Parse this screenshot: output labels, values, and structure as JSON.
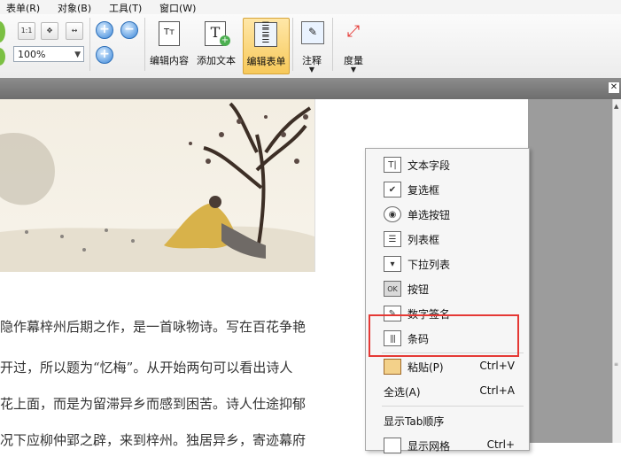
{
  "menubar": {
    "items": [
      "表单(R)",
      "对象(B)",
      "工具(T)",
      "窗口(W)"
    ]
  },
  "toolbar": {
    "zoom_value": "100%",
    "small_left_label": "1:1",
    "edit_content": "编辑内容",
    "add_text": "添加文本",
    "edit_form": "编辑表单",
    "annotate": "注释",
    "measure": "度量"
  },
  "document": {
    "lines": [
      "隐作幕梓州后期之作，是一首咏物诗。写在百花争艳",
      "开过，所以题为“忆梅”。从开始两句可以看出诗人",
      "花上面，而是为留滞异乡而感到困苦。诗人仕途抑郁",
      "况下应柳仲郢之辟，来到梓州。独居异乡，寄迹幕府"
    ]
  },
  "context_menu": {
    "items": [
      {
        "label": "文本字段",
        "icon": "text-field-icon",
        "glyph": "T|"
      },
      {
        "label": "复选框",
        "icon": "checkbox-icon",
        "glyph": "✔"
      },
      {
        "label": "单选按钮",
        "icon": "radio-button-icon",
        "glyph": "◉"
      },
      {
        "label": "列表框",
        "icon": "list-box-icon",
        "glyph": "☰"
      },
      {
        "label": "下拉列表",
        "icon": "dropdown-list-icon",
        "glyph": "▾"
      },
      {
        "label": "按钮",
        "icon": "button-icon",
        "glyph": "OK"
      },
      {
        "label": "数字签名",
        "icon": "digital-signature-icon",
        "glyph": "✎"
      },
      {
        "label": "条码",
        "icon": "barcode-icon",
        "glyph": "|||"
      }
    ],
    "paste": {
      "label": "粘贴(P)",
      "shortcut": "Ctrl+V"
    },
    "select_all": {
      "label": "全选(A)",
      "shortcut": "Ctrl+A"
    },
    "show_tab_order": {
      "label": "显示Tab顺序"
    },
    "partial": {
      "label": "显示网格",
      "shortcut": "Ctrl+"
    }
  },
  "colors": {
    "highlight": "#e53935",
    "active_tool": "#f7c95a"
  }
}
